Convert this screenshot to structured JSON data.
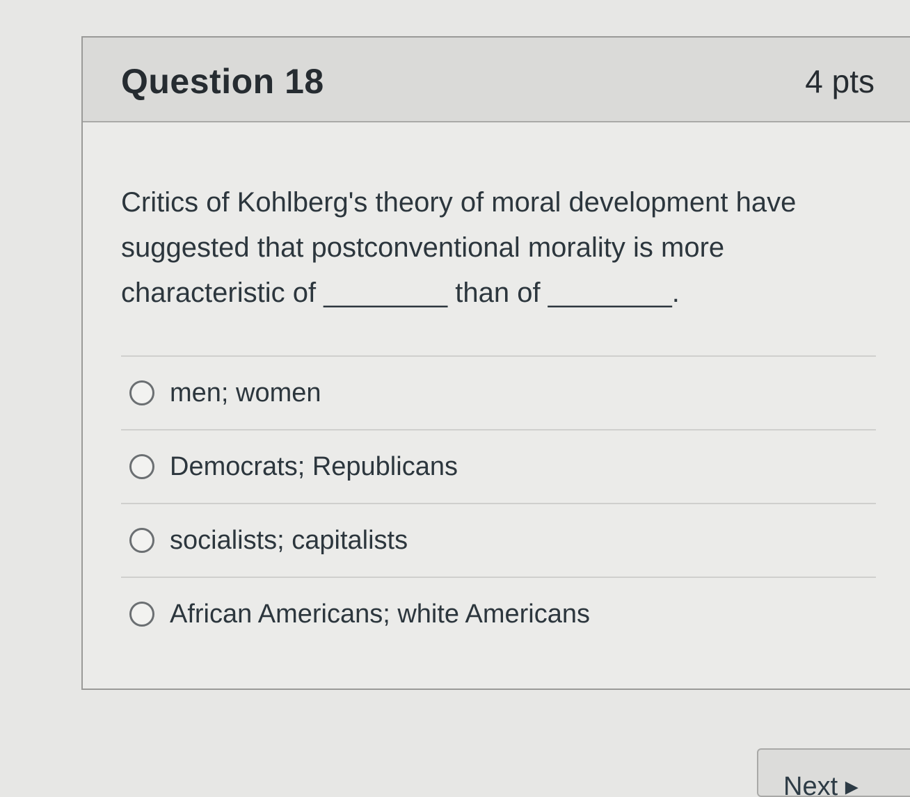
{
  "question": {
    "title": "Question 18",
    "points": "4 pts",
    "text": "Critics of Kohlberg's theory of moral development have suggested that postconventional morality is more characteristic of ________ than of ________."
  },
  "answers": [
    {
      "label": "men; women"
    },
    {
      "label": "Democrats; Republicans"
    },
    {
      "label": "socialists; capitalists"
    },
    {
      "label": "African Americans; white Americans"
    }
  ],
  "navigation": {
    "next_label": "Next ▸"
  }
}
